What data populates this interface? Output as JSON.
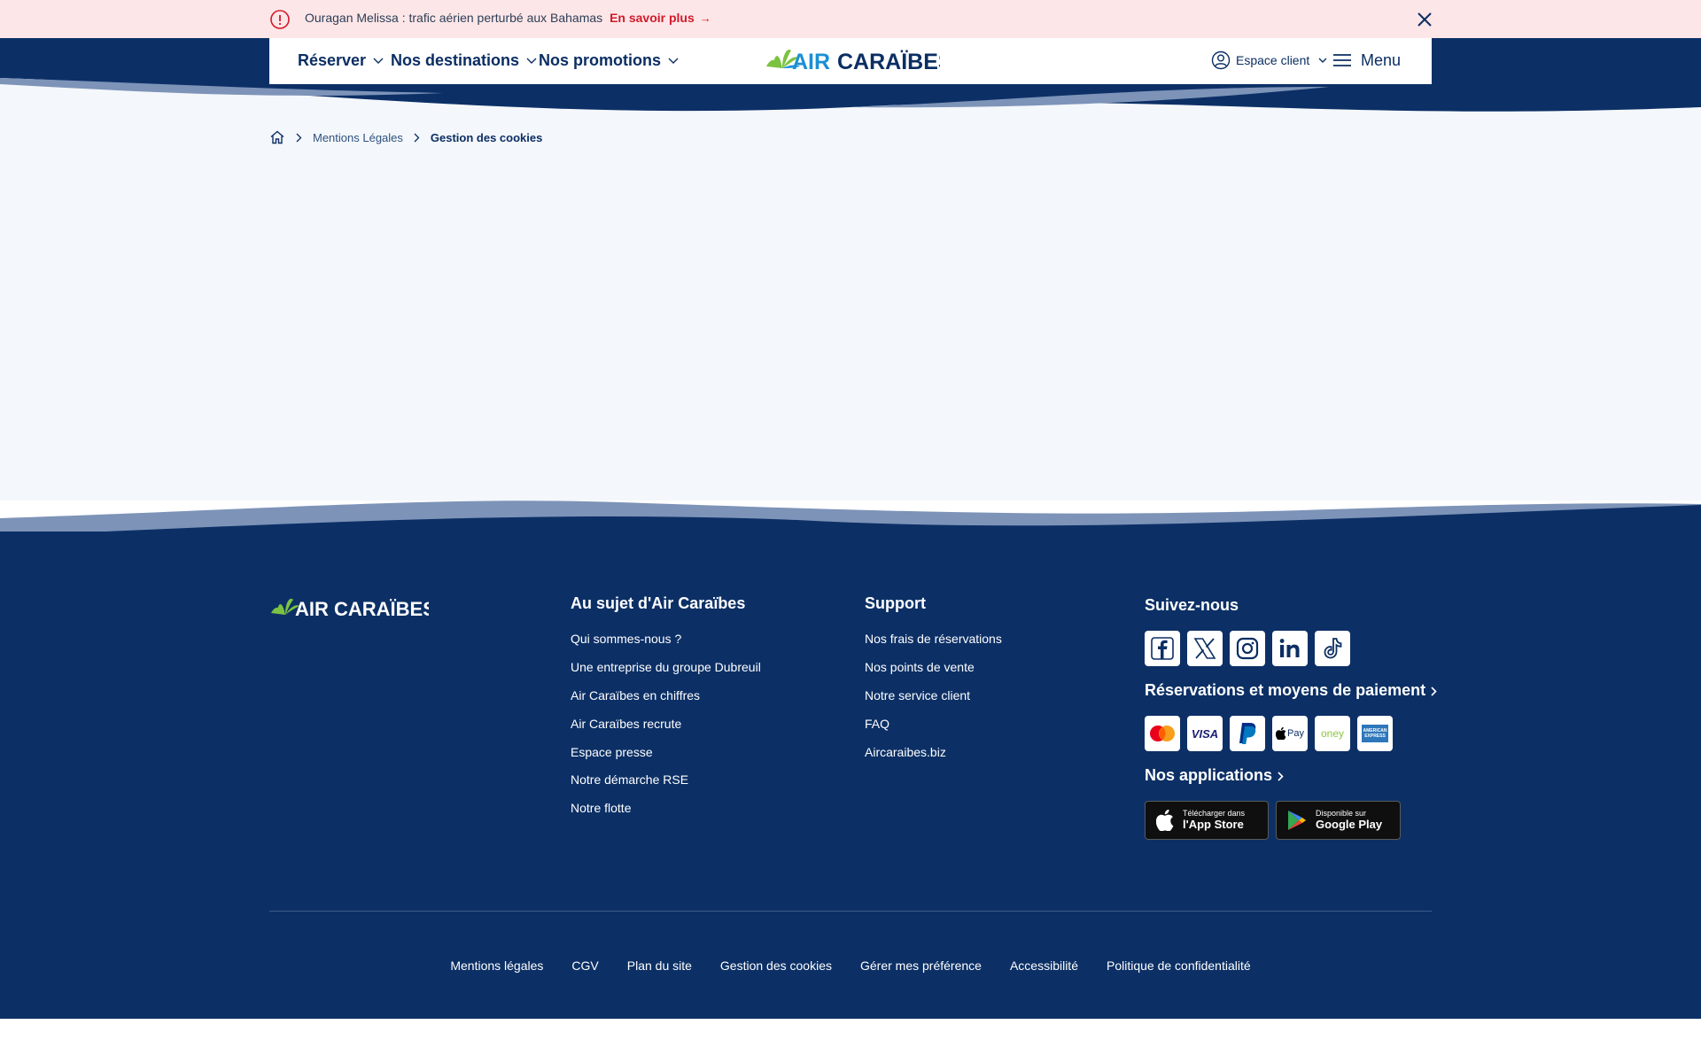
{
  "alert": {
    "message": "Ouragan Melissa : trafic aérien perturbé aux Bahamas",
    "link": "En savoir plus",
    "arrow": "→"
  },
  "header": {
    "nav": [
      "Réserver",
      "Nos destinations",
      "Nos promotions"
    ],
    "logo": {
      "air": "AIR",
      "caraibes": "CARAÏBES"
    },
    "account": "Espace client",
    "menu": "Menu"
  },
  "breadcrumb": {
    "items": [
      "Mentions Légales",
      "Gestion des cookies"
    ]
  },
  "footer": {
    "logo": {
      "air": "AIR",
      "caraibes": "CARAÏBES"
    },
    "about": {
      "title": "Au sujet d'Air Caraïbes",
      "links": [
        "Qui sommes-nous ?",
        "Une entreprise du groupe Dubreuil",
        "Air Caraïbes en chiffres",
        "Air Caraïbes recrute",
        "Espace presse",
        "Notre démarche RSE",
        "Notre flotte"
      ]
    },
    "support": {
      "title": "Support",
      "links": [
        "Nos frais de réservations",
        "Nos points de vente",
        "Notre service client",
        "FAQ",
        "Aircaraibes.biz"
      ]
    },
    "follow": {
      "title": "Suivez-nous",
      "networks": [
        "facebook-icon",
        "x-icon",
        "instagram-icon",
        "linkedin-icon",
        "tiktok-icon"
      ]
    },
    "payments": {
      "title": "Réservations et moyens de paiement",
      "methods": [
        "mastercard",
        "VISA",
        "paypal",
        "Pay",
        "oney",
        "AMERICAN EXPRESS"
      ]
    },
    "apps": {
      "title": "Nos applications",
      "appstore_small": "Télécharger dans",
      "appstore_big": "l'App Store",
      "googleplay_small": "Disponible sur",
      "googleplay_big": "Google Play"
    },
    "bottom_links": [
      "Mentions légales",
      "CGV",
      "Plan du site",
      "Gestion des cookies",
      "Gérer mes préférence",
      "Accessibilité",
      "Politique de confidentialité"
    ]
  },
  "colors": {
    "navy": "#0c3066",
    "alert_bg": "#fde6e8",
    "alert_red": "#d11a2a",
    "logo_blue": "#1a8fd6",
    "logo_green": "#7cc242"
  }
}
